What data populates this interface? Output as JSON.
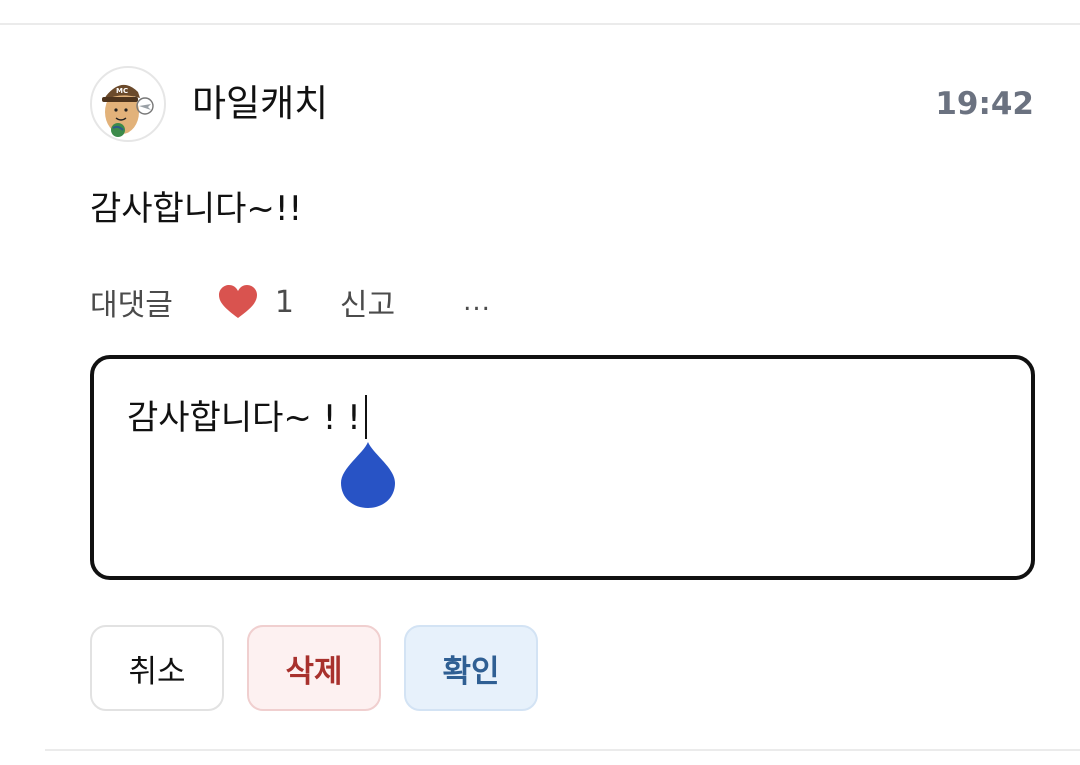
{
  "comment": {
    "author": "마일캐치",
    "time": "19:42",
    "text": "감사합니다~!!",
    "avatar_icon": "avatar-character-icon",
    "avatar_badge": "MC"
  },
  "actions": {
    "reply_label": "대댓글",
    "like_icon": "heart-icon",
    "like_count": "1",
    "report_label": "신고",
    "more_label": "..."
  },
  "editor": {
    "value": "감사합니다~ ! !",
    "caret_handle_icon": "caret-handle-icon"
  },
  "buttons": {
    "cancel_label": "취소",
    "delete_label": "삭제",
    "confirm_label": "확인"
  },
  "colors": {
    "heart": "#d9534f",
    "caret_handle": "#2853c5",
    "delete_text": "#a8312d",
    "confirm_text": "#2f5f93"
  }
}
